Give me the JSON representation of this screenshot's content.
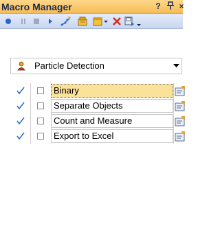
{
  "window": {
    "title": "Macro Manager",
    "pin_label": "?",
    "autohide_label": "‖",
    "close_label": "×"
  },
  "toolbar": {
    "buttons": [
      "record-icon",
      "pause-icon",
      "stop-icon",
      "play-icon",
      "step-icon",
      "new-macro-icon",
      "open-macro-icon",
      "delete-icon",
      "save-icon"
    ]
  },
  "macro_selector": {
    "icon": "person-icon",
    "selected": "Particle Detection"
  },
  "steps": [
    {
      "label": "Binary",
      "enabled": true,
      "breakpoint": false,
      "selected": true
    },
    {
      "label": "Separate Objects",
      "enabled": true,
      "breakpoint": false,
      "selected": false
    },
    {
      "label": "Count and Measure",
      "enabled": true,
      "breakpoint": false,
      "selected": false
    },
    {
      "label": "Export to Excel",
      "enabled": true,
      "breakpoint": false,
      "selected": false
    }
  ],
  "colors": {
    "title_bar": "#f7bd55",
    "toolbar": "#c9d7f0",
    "selected_row": "#fbe29a",
    "check": "#2a66c8"
  }
}
